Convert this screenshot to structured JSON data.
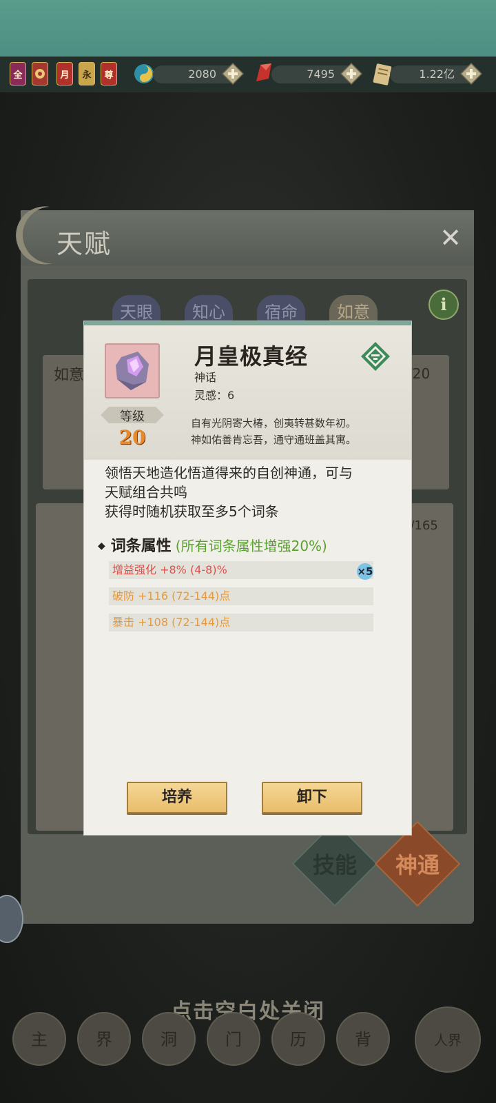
{
  "resources": {
    "badges": [
      "全",
      "",
      "月",
      "永",
      "尊"
    ],
    "jade": "2080",
    "crystal": "7495",
    "coins": "1.22亿"
  },
  "talent_panel": {
    "title": "天赋",
    "close": "✕",
    "tabs": [
      "天眼",
      "知心",
      "宿命",
      "如意"
    ],
    "info": "i",
    "ruyi_label": "如意",
    "ruyi_count": "/20",
    "lower_count": "0/165",
    "skill_button": "技能",
    "divine_button": "神通"
  },
  "modal": {
    "name": "月皇极真经",
    "rarity": "神话",
    "insight": "灵感：6",
    "level_label": "等级",
    "level_value": "20",
    "poem": [
      "自有光阴寄大椿，创夷转甚数年初。",
      "神如佑善肯忘吾，通守通班盖其寓。"
    ],
    "description": [
      "领悟天地造化悟道得来的自创神通，可与",
      "天赋组合共鸣",
      "获得时随机获取至多5个词条"
    ],
    "attr_header": "词条属性",
    "attr_bonus": "(所有词条属性增强20%)",
    "attributes": [
      {
        "text": "增益强化 +8% (4-8)%",
        "color": "#e0504a"
      },
      {
        "text": "破防 +116 (72-144)点",
        "color": "#e89a3a"
      },
      {
        "text": "暴击 +108 (72-144)点",
        "color": "#e89a3a"
      }
    ],
    "attr_multiplier": "×5",
    "cultivate_button": "培养",
    "unequip_button": "卸下"
  },
  "close_hint": "点击空白处关闭",
  "bottom_nav": [
    "主",
    "界",
    "洞",
    "门",
    "历",
    "背",
    "人界"
  ]
}
